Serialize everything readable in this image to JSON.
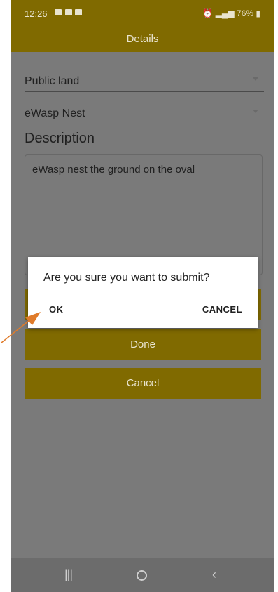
{
  "status_bar": {
    "time": "12:26",
    "battery": "76%"
  },
  "titlebar": {
    "title": "Details"
  },
  "form": {
    "location_value": "Public land",
    "category_value": "eWasp Nest",
    "description_heading": "Description",
    "description_text": "eWasp nest the ground on the oval"
  },
  "buttons": {
    "done_label": "Done",
    "cancel_label": "Cancel"
  },
  "dialog": {
    "message": "Are you sure you want to submit?",
    "ok_label": "OK",
    "cancel_label": "CANCEL"
  },
  "colors": {
    "accent": "#806a00",
    "annotation": "#e07b2a"
  },
  "icons": {
    "nav_recent": "recent-apps-icon",
    "nav_home": "home-icon",
    "nav_back": "back-icon"
  }
}
